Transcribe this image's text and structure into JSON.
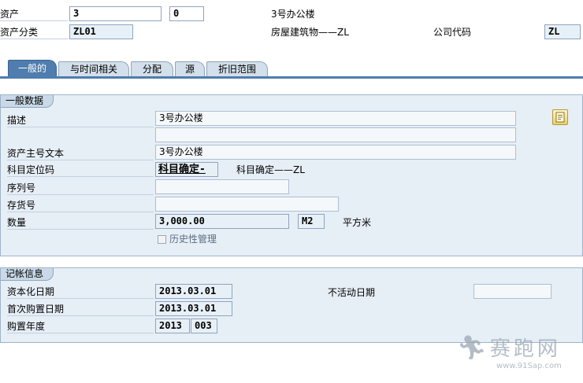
{
  "header": {
    "asset_label": "资产",
    "asset_number": "3",
    "sub_number": "0",
    "asset_description": "3号办公楼",
    "asset_class_label": "资产分类",
    "asset_class": "ZL01",
    "asset_class_text": "房屋建筑物——ZL",
    "company_code_label": "公司代码",
    "company_code": "ZL"
  },
  "tabs": [
    {
      "label": "一般的",
      "active": true
    },
    {
      "label": "与时间相关",
      "active": false
    },
    {
      "label": "分配",
      "active": false
    },
    {
      "label": "源",
      "active": false
    },
    {
      "label": "折旧范围",
      "active": false
    }
  ],
  "general": {
    "title": "一般数据",
    "description_label": "描述",
    "description": "3号办公楼",
    "description_2": "",
    "main_text_label": "资产主号文本",
    "main_text": "3号办公楼",
    "account_det_label": "科目定位码",
    "account_det": "科目确定-",
    "account_det_text": "科目确定——ZL",
    "serial_label": "序列号",
    "serial": "",
    "inventory_label": "存货号",
    "inventory": "",
    "quantity_label": "数量",
    "quantity": "3,000.00",
    "unit": "M2",
    "unit_text": "平方米",
    "history_label": "历史性管理",
    "history_checked": false
  },
  "posting": {
    "title": "记帐信息",
    "capitalized_label": "资本化日期",
    "capitalized": "2013.03.01",
    "first_acq_label": "首次购置日期",
    "first_acq": "2013.03.01",
    "acq_year_label": "购置年度",
    "acq_year": "2013",
    "acq_period": "003",
    "deactivation_label": "不活动日期",
    "deactivation": ""
  },
  "colors": {
    "tab_active": "#4f7dae",
    "panel": "#e6eef6",
    "field_border": "#8ea4bd"
  },
  "watermark": {
    "brand": "赛跑网",
    "url": "www.91Sap.com"
  }
}
